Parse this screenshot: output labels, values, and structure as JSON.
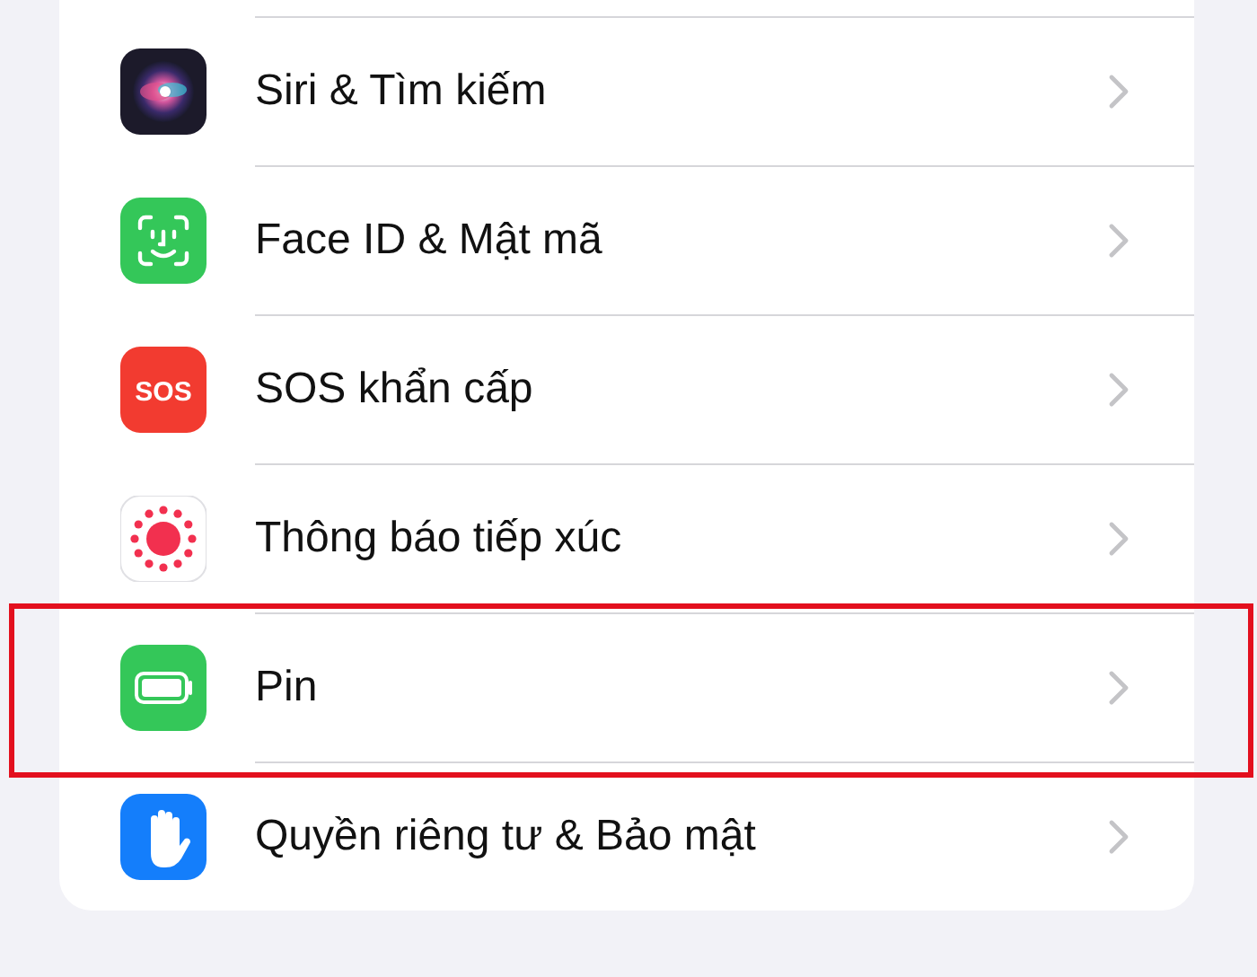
{
  "settings_list": [
    {
      "label": "Siri & Tìm kiếm",
      "highlighted": false
    },
    {
      "label": "Face ID & Mật mã",
      "highlighted": false
    },
    {
      "label": "SOS khẩn cấp",
      "icon_text": "SOS",
      "highlighted": false
    },
    {
      "label": "Thông báo tiếp xúc",
      "highlighted": false
    },
    {
      "label": "Pin",
      "highlighted": true
    },
    {
      "label": "Quyền riêng tư & Bảo mật",
      "highlighted": false
    }
  ]
}
